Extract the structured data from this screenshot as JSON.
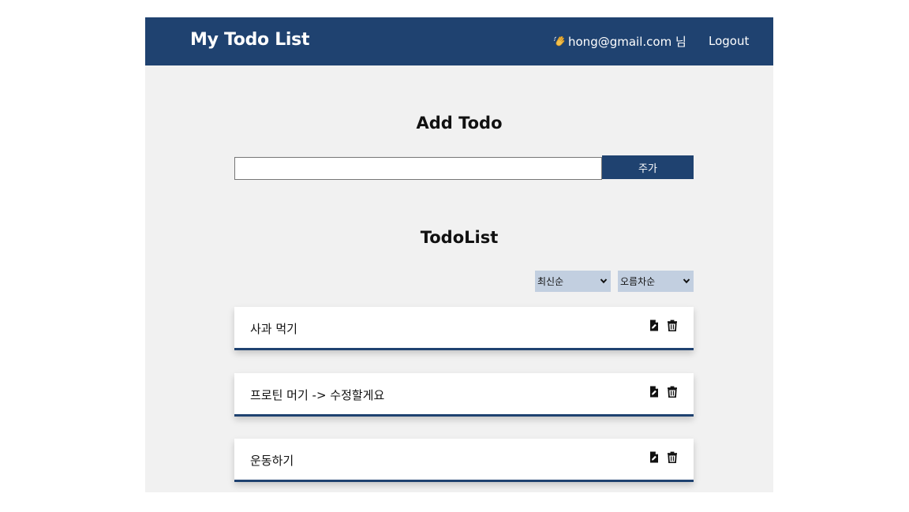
{
  "header": {
    "title": "My Todo List",
    "user_email": "hong@gmail.com 님",
    "logout_label": "Logout",
    "wave_icon": "waving-hand-icon"
  },
  "add_section": {
    "title": "Add Todo",
    "input_value": "",
    "input_placeholder": "",
    "add_button_label": "주가"
  },
  "list_section": {
    "title": "TodoList",
    "sort_select": {
      "selected": "최신순"
    },
    "order_select": {
      "selected": "오름차순"
    }
  },
  "todos": [
    {
      "text": "사과 먹기"
    },
    {
      "text": "프로틴 머기 -> 수정할게요"
    },
    {
      "text": "운동하기"
    }
  ],
  "colors": {
    "accent": "#1f4270",
    "background": "#f1f1f1",
    "select_bg": "#c2cfe0"
  },
  "icons": {
    "edit": "file-edit-icon",
    "delete": "trash-icon",
    "dropdown": "chevron-down-icon"
  }
}
